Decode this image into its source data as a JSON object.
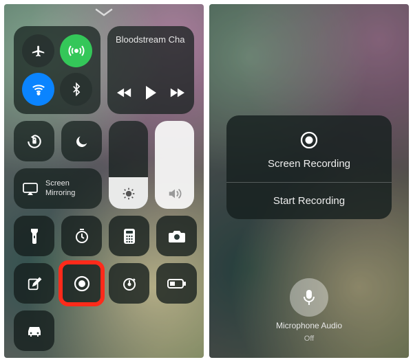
{
  "left": {
    "music_title": "Bloodstream Cha",
    "screen_mirroring_label": "Screen\nMirroring",
    "brightness_pct": 36,
    "icons": {
      "airplane": "airplane-icon",
      "cellular": "cellular-icon",
      "wifi": "wifi-icon",
      "bluetooth": "bluetooth-icon",
      "rewind": "rewind-icon",
      "play": "play-icon",
      "forward": "forward-icon",
      "orientation_lock": "orientation-lock-icon",
      "dnd": "moon-icon",
      "airplay": "airplay-icon",
      "brightness": "brightness-icon",
      "volume": "volume-icon",
      "flashlight": "flashlight-icon",
      "timer": "timer-icon",
      "calculator": "calculator-icon",
      "camera": "camera-icon",
      "notes": "compose-icon",
      "screen_record": "screen-record-icon",
      "stopwatch": "stopwatch-icon",
      "low_power": "low-power-icon",
      "car": "car-icon",
      "chevron": "chevron-down-icon"
    }
  },
  "right": {
    "title": "Screen Recording",
    "action": "Start Recording",
    "mic_label": "Microphone Audio",
    "mic_state": "Off"
  },
  "colors": {
    "green": "#34c759",
    "blue": "#0a84ff",
    "highlight": "#ff2a1a"
  }
}
